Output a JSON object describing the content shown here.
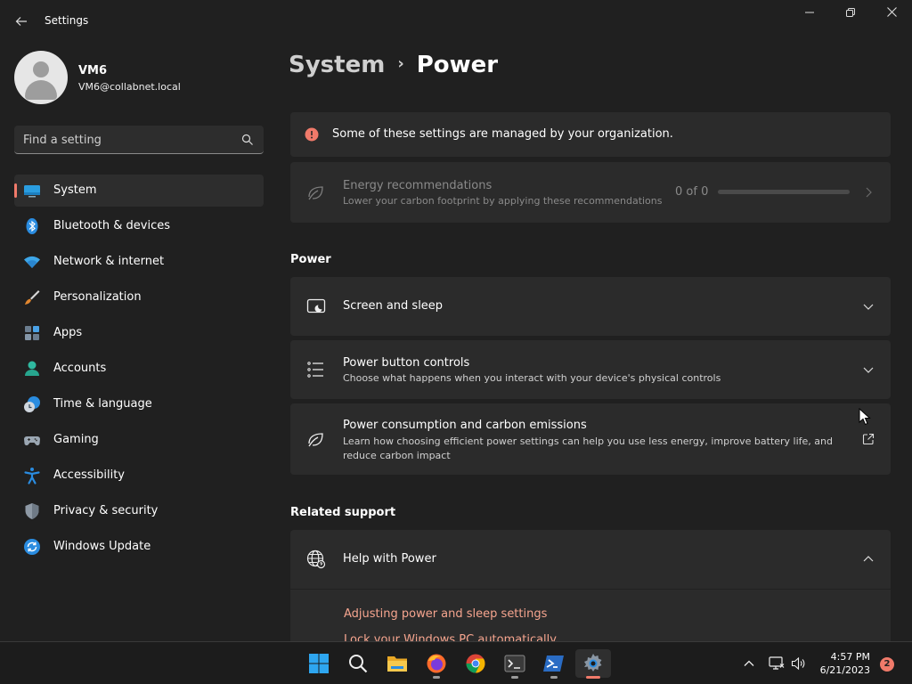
{
  "window": {
    "title": "Settings",
    "back_icon": "back-arrow-icon",
    "controls": [
      "minimize-icon",
      "restore-icon",
      "close-icon"
    ]
  },
  "user": {
    "name": "VM6",
    "email": "VM6@collabnet.local"
  },
  "search": {
    "placeholder": "Find a setting"
  },
  "sidebar": {
    "items": [
      {
        "label": "System",
        "icon": "system-icon",
        "selected": true
      },
      {
        "label": "Bluetooth & devices",
        "icon": "bluetooth-icon"
      },
      {
        "label": "Network & internet",
        "icon": "wifi-icon"
      },
      {
        "label": "Personalization",
        "icon": "brush-icon"
      },
      {
        "label": "Apps",
        "icon": "apps-icon"
      },
      {
        "label": "Accounts",
        "icon": "accounts-icon"
      },
      {
        "label": "Time & language",
        "icon": "clock-globe-icon"
      },
      {
        "label": "Gaming",
        "icon": "gamepad-icon"
      },
      {
        "label": "Accessibility",
        "icon": "accessibility-icon"
      },
      {
        "label": "Privacy & security",
        "icon": "shield-icon"
      },
      {
        "label": "Windows Update",
        "icon": "update-icon"
      }
    ]
  },
  "breadcrumb": {
    "parent": "System",
    "separator": "›",
    "current": "Power"
  },
  "managed_notice": {
    "text": "Some of these settings are managed by your organization.",
    "icon": "info-icon"
  },
  "energy": {
    "title": "Energy recommendations",
    "desc": "Lower your carbon footprint by applying these recommendations",
    "count": "0 of 0",
    "progress": 0,
    "icon": "leaf-icon"
  },
  "power_section": {
    "heading": "Power",
    "cards": [
      {
        "title": "Screen and sleep",
        "icon": "screen-sleep-icon"
      },
      {
        "title": "Power button controls",
        "desc": "Choose what happens when you interact with your device's physical controls",
        "icon": "list-settings-icon"
      },
      {
        "title": "Power consumption and carbon emissions",
        "desc1": "Learn how choosing efficient power settings can help you use less energy, improve battery life, and",
        "desc2": "reduce carbon impact",
        "icon": "leaf-icon"
      }
    ]
  },
  "support": {
    "heading": "Related support",
    "help_title": "Help with Power",
    "links": [
      "Adjusting power and sleep settings",
      "Lock your Windows PC automatically"
    ]
  },
  "taskbar": {
    "apps": [
      "start-icon",
      "search-icon",
      "file-explorer-icon",
      "firefox-icon",
      "chrome-icon",
      "terminal-icon",
      "powershell-icon",
      "settings-icon"
    ],
    "time": "4:57 PM",
    "date": "6/21/2023",
    "notifications": "2"
  },
  "colors": {
    "accent": "#f07a6a",
    "background": "#202020",
    "card": "#2b2b2b",
    "link": "#f6a58f"
  }
}
